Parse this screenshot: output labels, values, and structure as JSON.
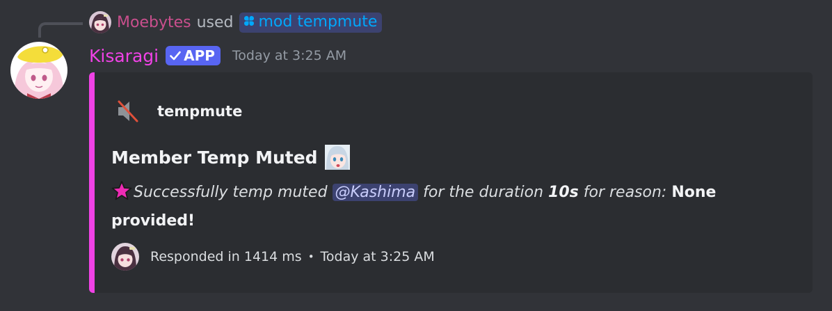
{
  "interaction": {
    "user": "Moebytes",
    "used_text": "used",
    "command": "mod tempmute",
    "command_icon": "slash-command-icon"
  },
  "message": {
    "author": "Kisaragi",
    "badge": "APP",
    "timestamp": "Today at 3:25 AM",
    "author_color": "#f042e6"
  },
  "embed": {
    "accent_color": "#f042e6",
    "author_icon": "muted-speaker-icon",
    "author_name": "tempmute",
    "title": "Member Temp Muted",
    "title_emoji": "anime-girl-emoji",
    "description": {
      "prefix_emoji": "star-icon",
      "text1": "Successfully temp muted",
      "mention": "@Kashima",
      "text2": "for the duration",
      "duration": "10s",
      "text3": "for reason:",
      "reason": "None provided!"
    },
    "footer": {
      "text": "Responded in 1414 ms",
      "separator": "•",
      "time": "Today at 3:25 AM"
    }
  }
}
